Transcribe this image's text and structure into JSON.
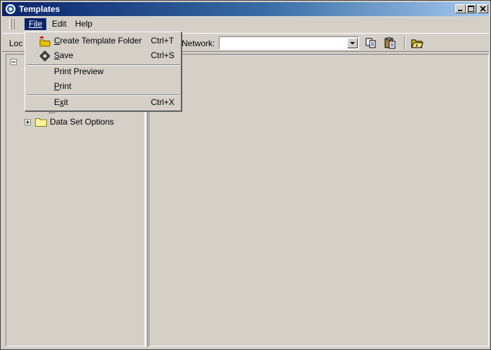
{
  "window": {
    "title": "Templates"
  },
  "menubar": {
    "file": "File",
    "edit": "Edit",
    "help": "Help"
  },
  "toolbar": {
    "location_label": "Loc",
    "network_label": "Network:",
    "network_value": ""
  },
  "tree": {
    "partial_label": "...",
    "items": [
      {
        "label": "Data Set Options",
        "expander": "plus"
      }
    ]
  },
  "file_menu": {
    "items": [
      {
        "label": "Create Template Folder",
        "shortcut": "Ctrl+T",
        "icon": "new-folder-icon"
      },
      {
        "label": "Save",
        "shortcut": "Ctrl+S",
        "icon": "save-icon"
      },
      {
        "label": "Print Preview",
        "shortcut": ""
      },
      {
        "label": "Print",
        "shortcut": ""
      },
      {
        "label": "Exit",
        "shortcut": "Ctrl+X"
      }
    ]
  },
  "colors": {
    "titlebar_start": "#0a246a",
    "titlebar_end": "#a6caf0",
    "menu_highlight": "#0a246a",
    "face": "#d4d0c8"
  }
}
